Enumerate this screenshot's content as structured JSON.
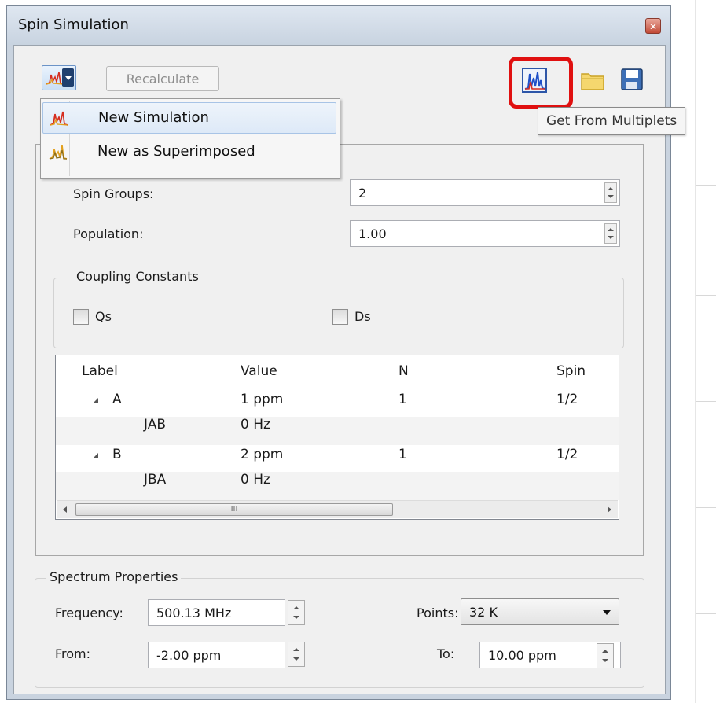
{
  "window": {
    "title": "Spin Simulation",
    "close_glyph": "✕"
  },
  "toolbar": {
    "recalculate_label": "Recalculate",
    "tooltip": "Get From Multiplets"
  },
  "menu": {
    "items": [
      {
        "label": "New Simulation"
      },
      {
        "label": "New as Superimposed"
      }
    ]
  },
  "settings": {
    "spin_groups_label": "Spin Groups:",
    "spin_groups_value": "2",
    "population_label": "Population:",
    "population_value": "1.00"
  },
  "coupling": {
    "caption": "Coupling Constants",
    "qs_label": "Qs",
    "ds_label": "Ds"
  },
  "table": {
    "columns": [
      "Label",
      "Value",
      "N",
      "Spin"
    ],
    "rows": [
      {
        "label": "A",
        "value": "1 ppm",
        "n": "1",
        "spin": "1/2"
      },
      {
        "label": "JAB",
        "value": "0 Hz",
        "n": "",
        "spin": ""
      },
      {
        "label": "B",
        "value": "2 ppm",
        "n": "1",
        "spin": "1/2"
      },
      {
        "label": "JBA",
        "value": "0 Hz",
        "n": "",
        "spin": ""
      }
    ],
    "scroll_thumb_grip": "III"
  },
  "spectrum": {
    "caption": "Spectrum Properties",
    "frequency_label": "Frequency:",
    "frequency_value": "500.13 MHz",
    "points_label": "Points:",
    "points_value": "32 K",
    "from_label": "From:",
    "from_value": "-2.00 ppm",
    "to_label": "To:",
    "to_value": "10.00 ppm"
  },
  "colors": {
    "highlight": "#e01010",
    "spectrum_red": "#d62d20",
    "spectrum_blue": "#1e50c8"
  }
}
